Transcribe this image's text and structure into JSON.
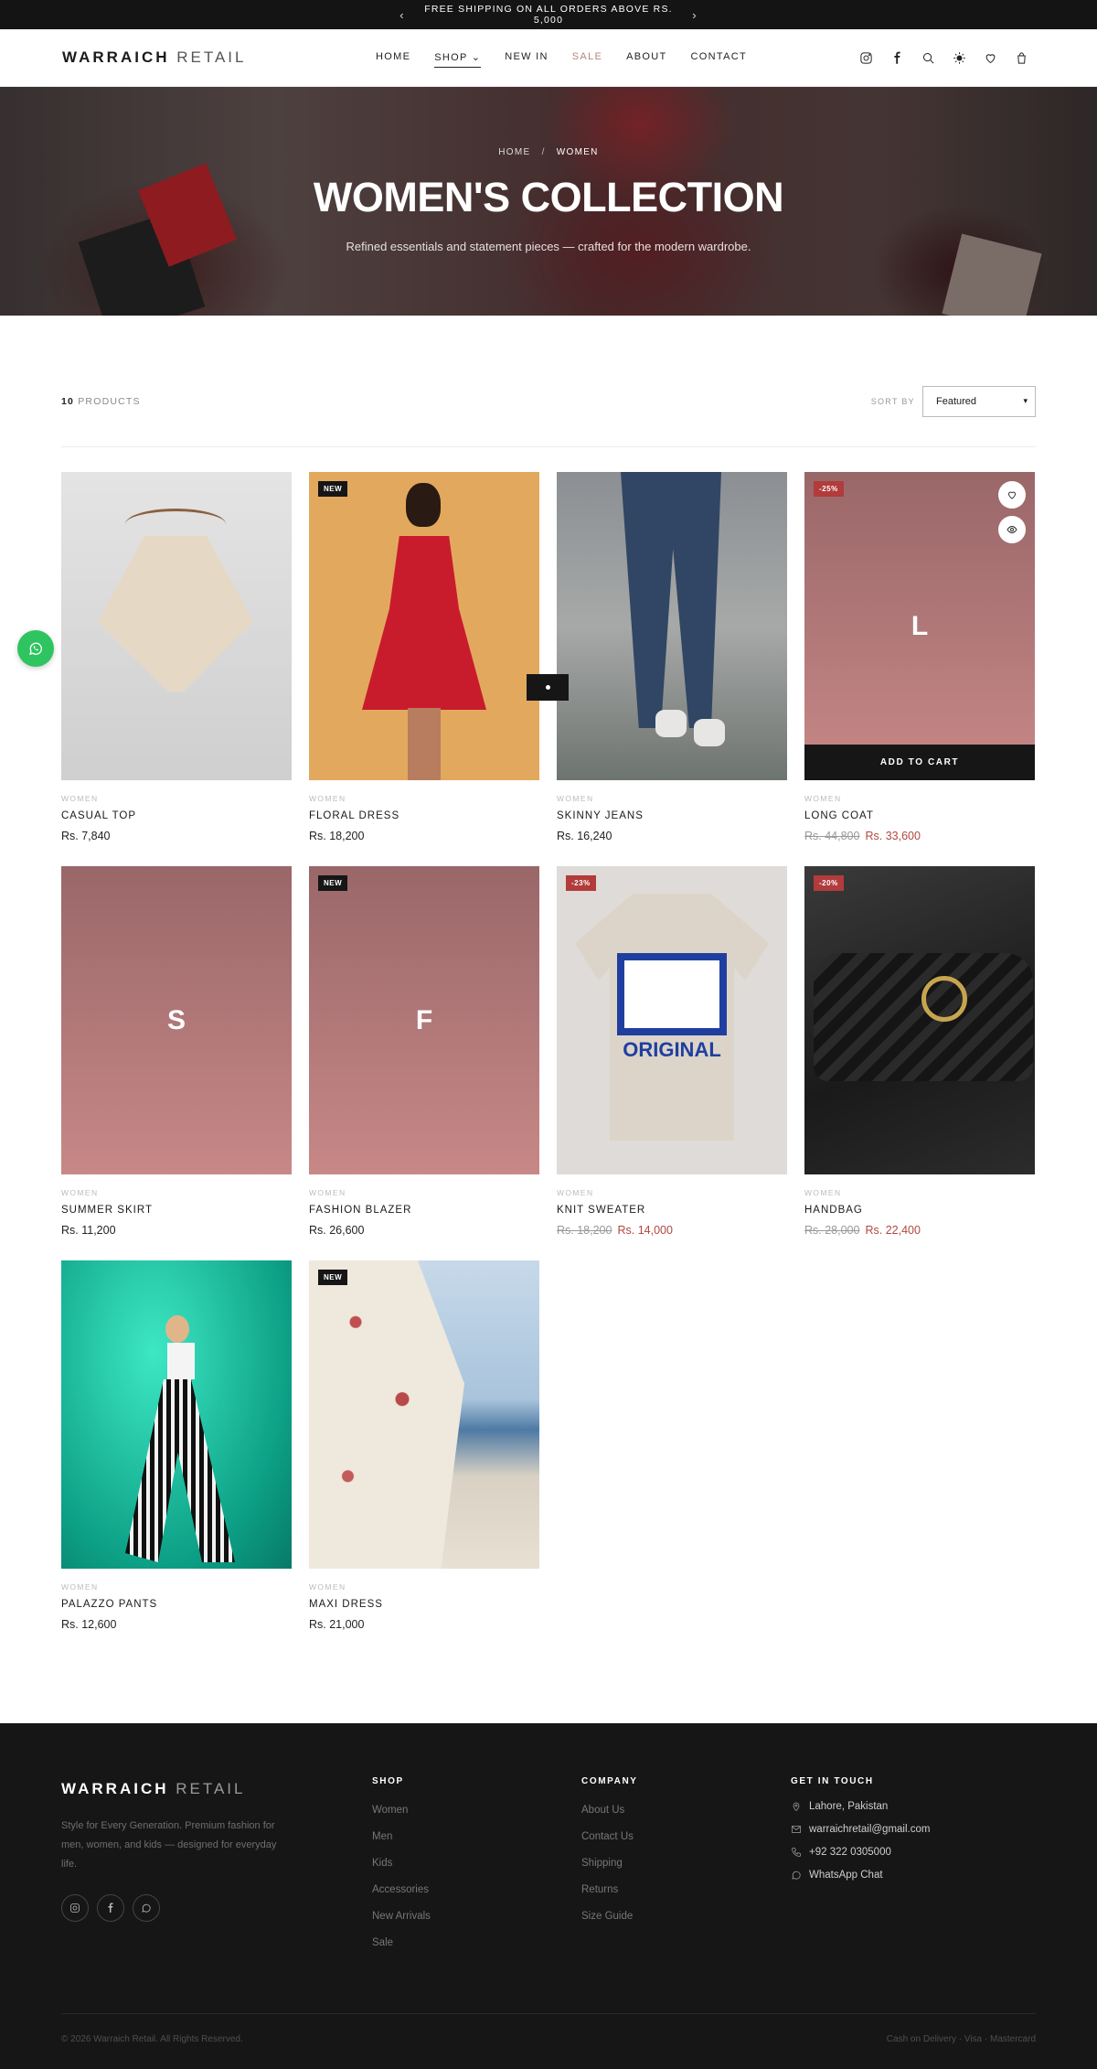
{
  "announcement": {
    "text": "FREE SHIPPING ON ALL ORDERS ABOVE RS. 5,000",
    "prev": "‹",
    "next": "›"
  },
  "header": {
    "logo_bold": "WARRAICH",
    "logo_light": "RETAIL",
    "nav": [
      {
        "label": "HOME"
      },
      {
        "label": "SHOP ⌄"
      },
      {
        "label": "NEW IN"
      },
      {
        "label": "SALE"
      },
      {
        "label": "ABOUT"
      },
      {
        "label": "CONTACT"
      }
    ]
  },
  "hero": {
    "breadcrumb_home": "HOME",
    "breadcrumb_sep": "/",
    "breadcrumb_current": "WOMEN",
    "title": "WOMEN'S COLLECTION",
    "subtitle": "Refined essentials and statement pieces — crafted for the modern wardrobe."
  },
  "toolbar": {
    "count_number": "10",
    "count_label": "PRODUCTS",
    "sort_label": "SORT BY",
    "sort_value": "Featured"
  },
  "products": [
    {
      "category": "WOMEN",
      "name": "CASUAL TOP",
      "price": "Rs. 7,840",
      "old_price": "",
      "badge": ""
    },
    {
      "category": "WOMEN",
      "name": "FLORAL DRESS",
      "price": "Rs. 18,200",
      "old_price": "",
      "badge": "NEW"
    },
    {
      "category": "WOMEN",
      "name": "SKINNY JEANS",
      "price": "Rs. 16,240",
      "old_price": "",
      "badge": ""
    },
    {
      "category": "WOMEN",
      "name": "LONG COAT",
      "price": "Rs. 33,600",
      "old_price": "Rs. 44,800",
      "badge": "-25%",
      "placeholder": "L",
      "add_to_cart": "ADD TO CART"
    },
    {
      "category": "WOMEN",
      "name": "SUMMER SKIRT",
      "price": "Rs. 11,200",
      "old_price": "",
      "badge": "",
      "placeholder": "S"
    },
    {
      "category": "WOMEN",
      "name": "FASHION BLAZER",
      "price": "Rs. 26,600",
      "old_price": "",
      "badge": "NEW",
      "placeholder": "F"
    },
    {
      "category": "WOMEN",
      "name": "KNIT SWEATER",
      "price": "Rs. 14,000",
      "old_price": "Rs. 18,200",
      "badge": "-23%",
      "tee_text": "ORIGINAL"
    },
    {
      "category": "WOMEN",
      "name": "HANDBAG",
      "price": "Rs. 22,400",
      "old_price": "Rs. 28,000",
      "badge": "-20%"
    },
    {
      "category": "WOMEN",
      "name": "PALAZZO PANTS",
      "price": "Rs. 12,600",
      "old_price": "",
      "badge": ""
    },
    {
      "category": "WOMEN",
      "name": "MAXI DRESS",
      "price": "Rs. 21,000",
      "old_price": "",
      "badge": "NEW"
    }
  ],
  "footer": {
    "logo_bold": "WARRAICH",
    "logo_light": "RETAIL",
    "tagline": "Style for Every Generation. Premium fashion for men, women, and kids — designed for everyday life.",
    "shop_title": "SHOP",
    "shop_links": [
      "Women",
      "Men",
      "Kids",
      "Accessories",
      "New Arrivals",
      "Sale"
    ],
    "company_title": "COMPANY",
    "company_links": [
      "About Us",
      "Contact Us",
      "Shipping",
      "Returns",
      "Size Guide"
    ],
    "contact_title": "GET IN TOUCH",
    "location": "Lahore, Pakistan",
    "email": "warraichretail@gmail.com",
    "phone": "+92 322 0305000",
    "whatsapp": "WhatsApp Chat",
    "copyright": "© 2026 Warraich Retail. All Rights Reserved.",
    "payments": "Cash on Delivery · Visa · Mastercard"
  },
  "colors": {
    "accent_sale": "#b5897a",
    "discount_badge": "#b23b3b",
    "dark": "#161616",
    "whatsapp": "#2ec45f"
  }
}
